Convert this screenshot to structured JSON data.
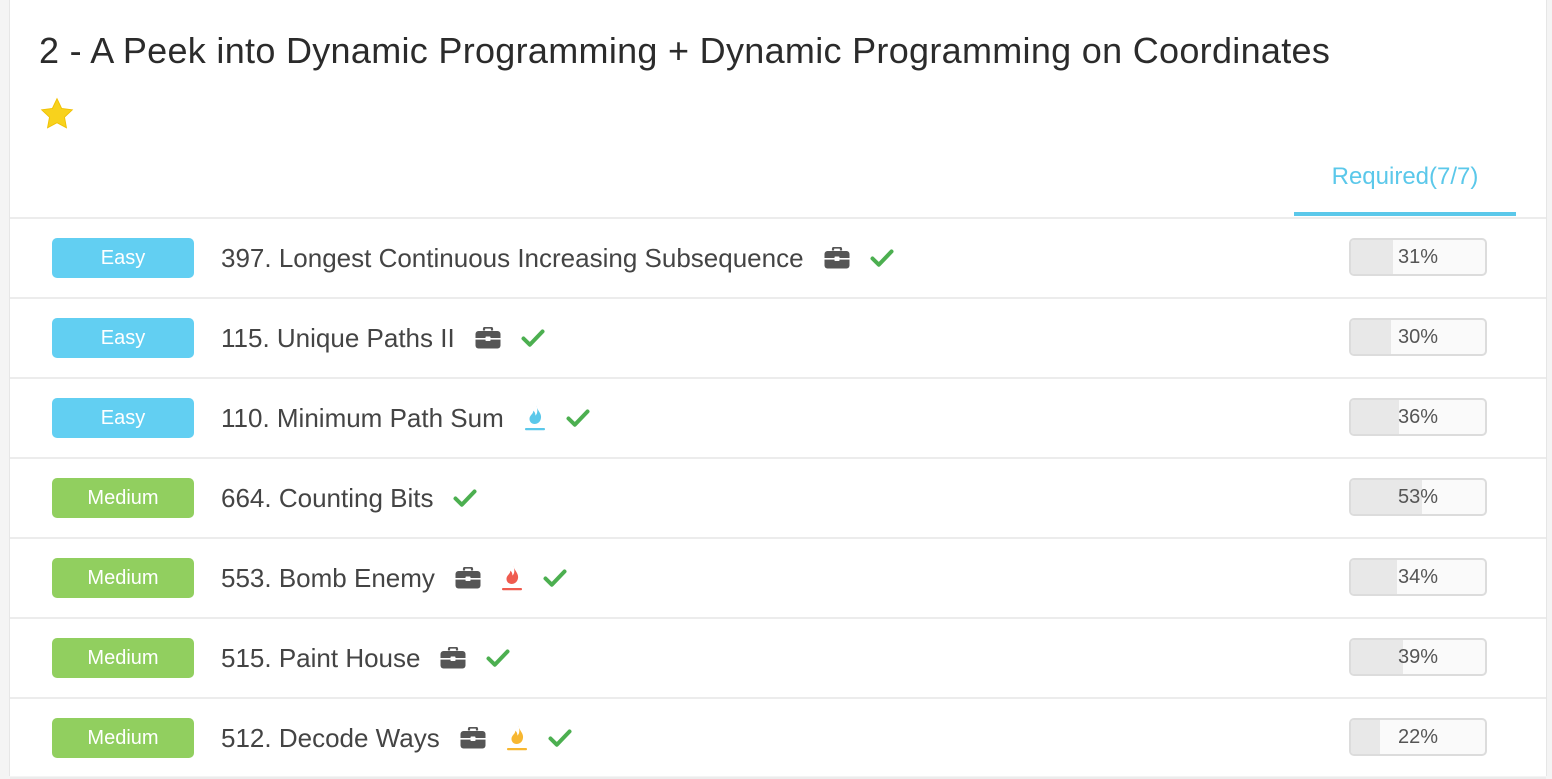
{
  "header": {
    "title": "2 - A Peek into Dynamic Programming + Dynamic Programming on Coordinates",
    "star_icon": "star-icon"
  },
  "tab": {
    "label": "Required(7/7)",
    "active": true,
    "color": "#5bc8ea"
  },
  "colors": {
    "easy": "#62cff2",
    "medium": "#91cf5f",
    "check": "#4caf50",
    "briefcase": "#555555",
    "flame_cold": "#5bc8ea",
    "flame_hot": "#ef5b4f",
    "flame_warm": "#f7b731"
  },
  "problems": [
    {
      "difficulty": "Easy",
      "title": "397. Longest Continuous Increasing Subsequence",
      "icons": [
        "briefcase-icon"
      ],
      "solved": true,
      "rate": "31%"
    },
    {
      "difficulty": "Easy",
      "title": "115. Unique Paths II",
      "icons": [
        "briefcase-icon"
      ],
      "solved": true,
      "rate": "30%"
    },
    {
      "difficulty": "Easy",
      "title": "110. Minimum Path Sum",
      "icons": [
        "flame-blue-icon"
      ],
      "solved": true,
      "rate": "36%"
    },
    {
      "difficulty": "Medium",
      "title": "664. Counting Bits",
      "icons": [],
      "solved": true,
      "rate": "53%"
    },
    {
      "difficulty": "Medium",
      "title": "553. Bomb Enemy",
      "icons": [
        "briefcase-icon",
        "flame-red-icon"
      ],
      "solved": true,
      "rate": "34%"
    },
    {
      "difficulty": "Medium",
      "title": "515. Paint House",
      "icons": [
        "briefcase-icon"
      ],
      "solved": true,
      "rate": "39%"
    },
    {
      "difficulty": "Medium",
      "title": "512. Decode Ways",
      "icons": [
        "briefcase-icon",
        "flame-orange-icon"
      ],
      "solved": true,
      "rate": "22%"
    }
  ]
}
